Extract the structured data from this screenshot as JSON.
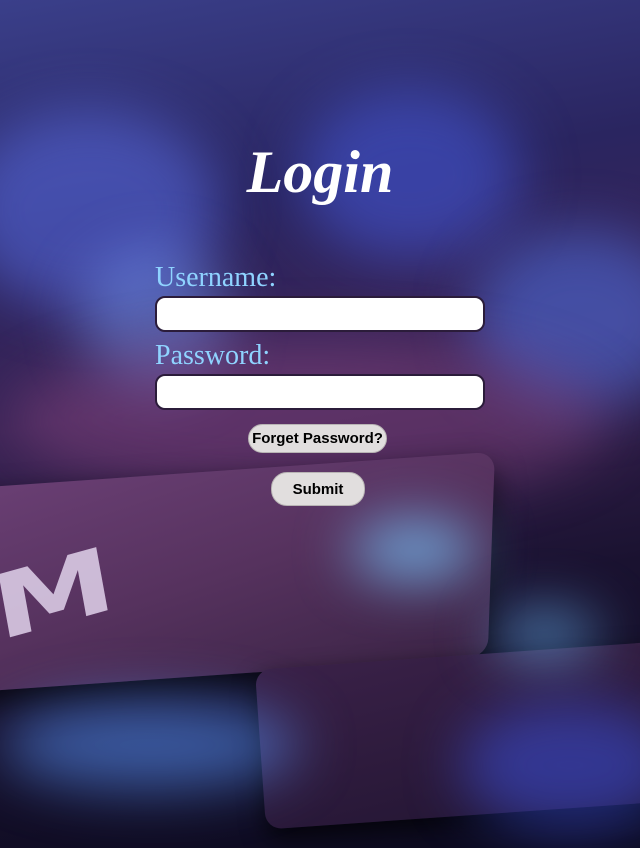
{
  "title": "Login",
  "form": {
    "username_label": "Username:",
    "username_value": "",
    "password_label": "Password:",
    "password_value": "",
    "forget_label": "Forget Password?",
    "submit_label": "Submit"
  },
  "background": {
    "key_letter": "M"
  }
}
